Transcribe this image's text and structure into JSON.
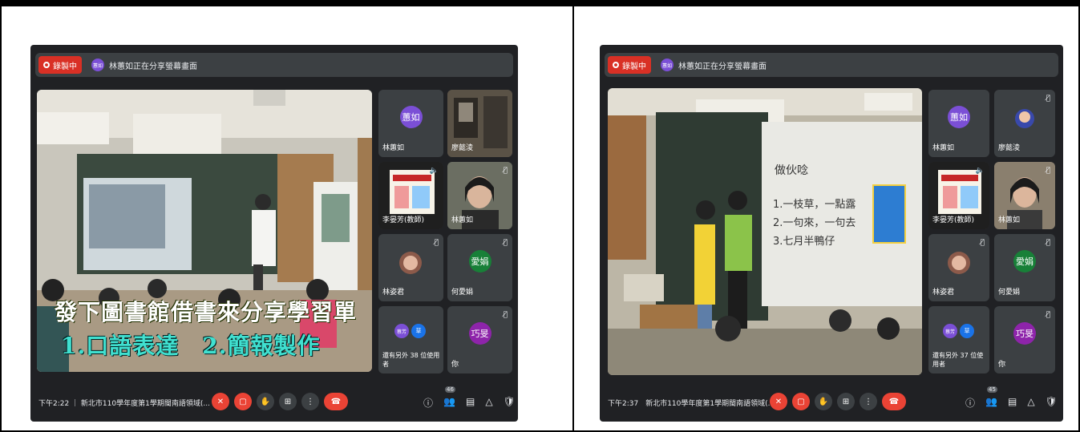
{
  "panels": [
    {
      "recording_label": "錄製中",
      "presenter_initials": "蕙如",
      "share_text": "林蕙如正在分享螢幕畫面",
      "overlay_line1": "發下圖書館借書來分享學習單",
      "overlay_line2": "1.口語表達　2.簡報製作",
      "slide": {
        "title": "",
        "lines": []
      },
      "tiles": [
        {
          "name": "林蕙如",
          "avatar": "蕙如",
          "color": "#7b4fd6",
          "muted": false
        },
        {
          "name": "廖懿淩",
          "avatar": "",
          "color": "",
          "muted": false
        },
        {
          "name": "李晏芳(教師)",
          "avatar": "",
          "color": "",
          "muted": false
        },
        {
          "name": "林蕙如",
          "avatar": "",
          "color": "",
          "muted": true
        },
        {
          "name": "林姿君",
          "avatar": "",
          "color": "",
          "muted": true
        },
        {
          "name": "何愛娟",
          "avatar": "愛娟",
          "color": "#188038",
          "muted": true
        },
        {
          "name": "還有另外 38 位使用者",
          "avatar": "",
          "color": "",
          "muted": false
        },
        {
          "name": "你",
          "avatar": "巧旻",
          "color": "#8e24aa",
          "muted": true
        }
      ],
      "others_avatars": [
        "蔡芳",
        "草"
      ],
      "meeting_info": "下午2:22 ｜ 新北市110學年度第1學期閩南語領域(...",
      "participant_count": "46"
    },
    {
      "recording_label": "錄製中",
      "presenter_initials": "蕙如",
      "share_text": "林蕙如正在分享螢幕畫面",
      "overlay_line1": "",
      "overlay_line2": "",
      "slide": {
        "title": "做伙唸",
        "lines": [
          "1.一枝草，一點露",
          "2.一句來，一句去",
          "3.七月半鴨仔"
        ]
      },
      "tiles": [
        {
          "name": "林蕙如",
          "avatar": "蕙如",
          "color": "#7b4fd6",
          "muted": false
        },
        {
          "name": "廖懿淩",
          "avatar": "",
          "color": "",
          "muted": true
        },
        {
          "name": "李晏芳(教師)",
          "avatar": "",
          "color": "",
          "muted": false
        },
        {
          "name": "林蕙如",
          "avatar": "",
          "color": "",
          "muted": true
        },
        {
          "name": "林姿君",
          "avatar": "",
          "color": "",
          "muted": true
        },
        {
          "name": "何愛娟",
          "avatar": "愛娟",
          "color": "#188038",
          "muted": true
        },
        {
          "name": "還有另外 37 位使用者",
          "avatar": "",
          "color": "",
          "muted": false
        },
        {
          "name": "你",
          "avatar": "巧旻",
          "color": "#8e24aa",
          "muted": true
        }
      ],
      "others_avatars": [
        "蔡芳",
        "草"
      ],
      "meeting_info": "下午2:37　新北市110學年度第1學期閩南語領域(...",
      "participant_count": "45"
    }
  ],
  "icons": {
    "mic_off": "mic-off-icon",
    "cam_off": "camera-off-icon",
    "hand": "raise-hand-icon",
    "present": "present-icon",
    "more": "more-options-icon",
    "hangup": "hang-up-icon",
    "info": "info-icon",
    "people": "people-icon",
    "chat": "chat-icon",
    "activities": "activities-icon",
    "host": "host-controls-icon"
  },
  "colors": {
    "meet_bg": "#202124",
    "tile_bg": "#3c4043",
    "red": "#ea4335",
    "record": "#d93025"
  }
}
